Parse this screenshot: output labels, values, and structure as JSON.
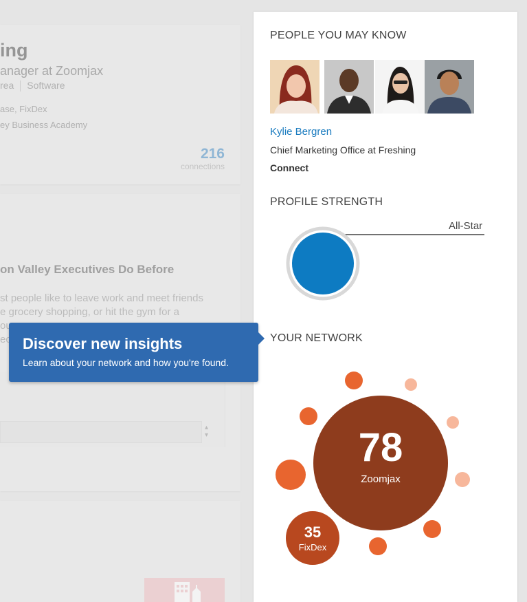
{
  "profile": {
    "name": "ing",
    "title": "anager at Zoomjax",
    "meta_area": "rea",
    "meta_industry": "Software",
    "line1": "ase, FixDex",
    "line2": "ey Business Academy",
    "connections_count": "216",
    "connections_label": "connections"
  },
  "article": {
    "title": "on Valley Executives Do Before",
    "text_line1": "st people like to leave work and meet friends",
    "text_line2": "e grocery shopping, or hit the gym for a",
    "text_line3": "ou",
    "text_line4": "ec"
  },
  "tooltip": {
    "title": "Discover new insights",
    "subtitle": "Learn about your network and how you're found."
  },
  "people_you_may_know": {
    "title": "PEOPLE YOU MAY KNOW",
    "featured_name": "Kylie Bergren",
    "featured_title": "Chief Marketing Office at Freshing",
    "connect_label": "Connect"
  },
  "profile_strength": {
    "title": "PROFILE STRENGTH",
    "level_label": "All-Star"
  },
  "your_network": {
    "title": "YOUR NETWORK",
    "main_count": "78",
    "main_label": "Zoomjax",
    "secondary_count": "35",
    "secondary_label": "FixDex"
  },
  "colors": {
    "accent_blue": "#2f6ab0",
    "link_blue": "#1a7bbf",
    "strength_fill": "#0d7bc2",
    "network_main": "#8e3c1d",
    "network_secondary": "#b8481f",
    "network_dot": "#e8652f",
    "network_dot_light": "#f7b79b"
  }
}
